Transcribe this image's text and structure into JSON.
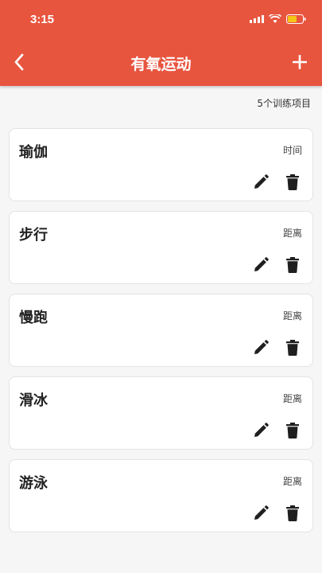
{
  "status_bar": {
    "time": "3:15"
  },
  "header": {
    "title": "有氧运动",
    "back_icon": "back-arrow-icon",
    "add_icon": "plus-icon",
    "background_color": "#e8553f"
  },
  "summary": {
    "count_label": "5个训练项目"
  },
  "exercises": [
    {
      "name": "瑜伽",
      "type": "时间"
    },
    {
      "name": "步行",
      "type": "距离"
    },
    {
      "name": "慢跑",
      "type": "距离"
    },
    {
      "name": "滑冰",
      "type": "距离"
    },
    {
      "name": "游泳",
      "type": "距离"
    }
  ],
  "icons": {
    "edit": "pencil-icon",
    "delete": "trash-icon"
  }
}
